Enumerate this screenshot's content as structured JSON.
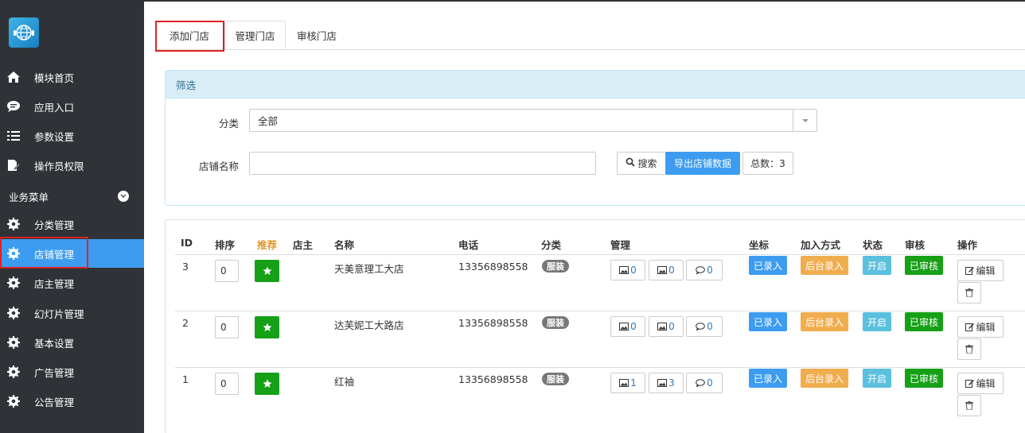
{
  "sidebar": {
    "items": [
      {
        "label": "模块首页",
        "icon": "home-icon"
      },
      {
        "label": "应用入口",
        "icon": "chat-bubble-icon"
      },
      {
        "label": "参数设置",
        "icon": "list-icon"
      },
      {
        "label": "操作员权限",
        "icon": "edit-doc-icon"
      }
    ],
    "section_label": "业务菜单",
    "business_items": [
      {
        "label": "分类管理",
        "icon": "gear-icon"
      },
      {
        "label": "店铺管理",
        "icon": "gear-icon"
      },
      {
        "label": "店主管理",
        "icon": "gear-icon"
      },
      {
        "label": "幻灯片管理",
        "icon": "gear-icon"
      },
      {
        "label": "基本设置",
        "icon": "gear-icon"
      },
      {
        "label": "广告管理",
        "icon": "gear-icon"
      },
      {
        "label": "公告管理",
        "icon": "gear-icon"
      }
    ]
  },
  "tabs": [
    "添加门店",
    "管理门店",
    "审核门店"
  ],
  "filter": {
    "title": "筛选",
    "category_label": "分类",
    "category_value": "全部",
    "name_label": "店铺名称",
    "name_value": "",
    "search_label": "搜索",
    "export_label": "导出店铺数据",
    "total_label": "总数：3"
  },
  "table": {
    "headers": [
      "ID",
      "排序",
      "推荐",
      "店主",
      "名称",
      "电话",
      "分类",
      "管理",
      "坐标",
      "加入方式",
      "状态",
      "审核",
      "操作"
    ],
    "rows": [
      {
        "id": "3",
        "order": "0",
        "owner": "",
        "name": "天美意理工大店",
        "phone": "13356898558",
        "category": "服装",
        "m1": "0",
        "m2": "0",
        "m3": "0",
        "coord": "已录入",
        "join": "后台录入",
        "status": "开启",
        "audit": "已审核",
        "edit": "编辑"
      },
      {
        "id": "2",
        "order": "0",
        "owner": "",
        "name": "达芙妮工大路店",
        "phone": "13356898558",
        "category": "服装",
        "m1": "0",
        "m2": "0",
        "m3": "0",
        "coord": "已录入",
        "join": "后台录入",
        "status": "开启",
        "audit": "已审核",
        "edit": "编辑"
      },
      {
        "id": "1",
        "order": "0",
        "owner": "",
        "name": "红袖",
        "phone": "13356898558",
        "category": "服装",
        "m1": "1",
        "m2": "3",
        "m3": "0",
        "coord": "已录入",
        "join": "后台录入",
        "status": "开启",
        "audit": "已审核",
        "edit": "编辑"
      }
    ]
  },
  "colors": {
    "sidebar_bg": "#2f3337",
    "active_blue": "#3d9cf0",
    "highlight_red": "#e02020",
    "green": "#16a016",
    "orange": "#f0ad4e",
    "teal": "#5bc0de"
  }
}
